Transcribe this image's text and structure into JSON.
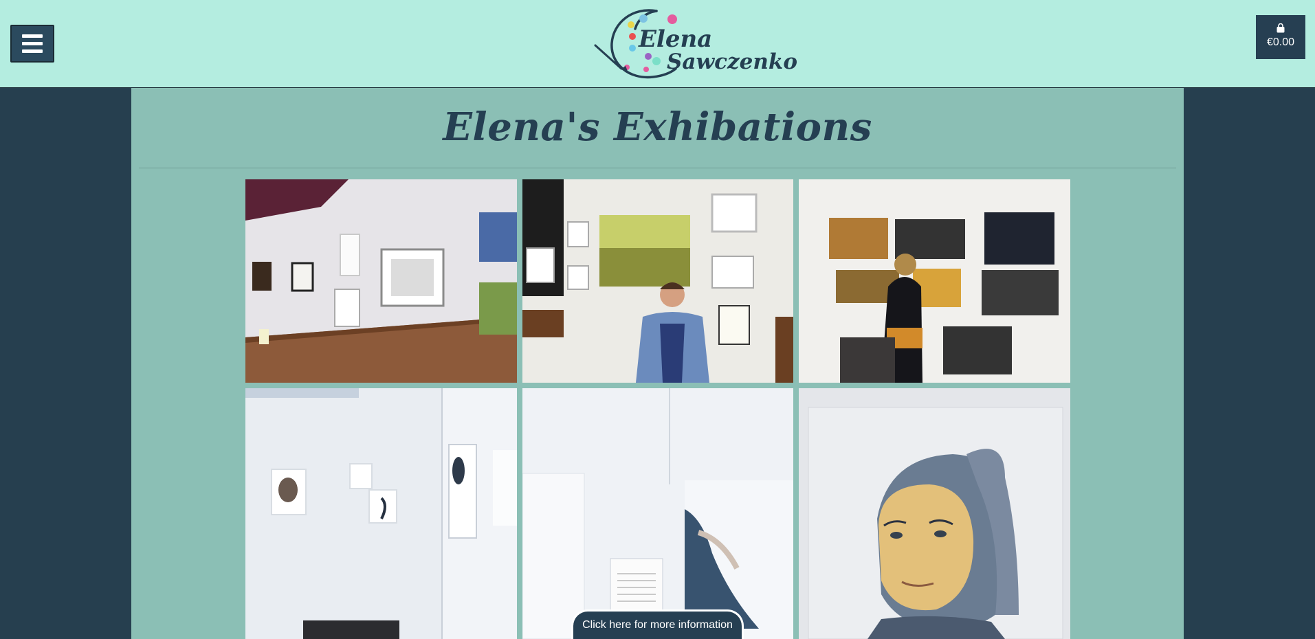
{
  "brand": {
    "first_name": "Elena",
    "last_name": "Sawczenko"
  },
  "cart": {
    "total": "€0.00"
  },
  "page": {
    "title": "Elena's Exhibations"
  },
  "gallery": {
    "photos": [
      {
        "label": "exhibition-gallery-wall-photo"
      },
      {
        "label": "artist-standing-by-paintings-photo"
      },
      {
        "label": "artist-hanging-paintings-photo"
      },
      {
        "label": "portrait-room-corner-photo"
      },
      {
        "label": "portrait-wall-with-text-panel-photo"
      },
      {
        "label": "girl-portrait-painting-photo"
      }
    ]
  },
  "info_tab": {
    "label": "Click here for more information"
  },
  "colors": {
    "header": "#b4ede0",
    "background": "#263f4f",
    "content": "#8bbfb5",
    "accent": "#253f52"
  }
}
